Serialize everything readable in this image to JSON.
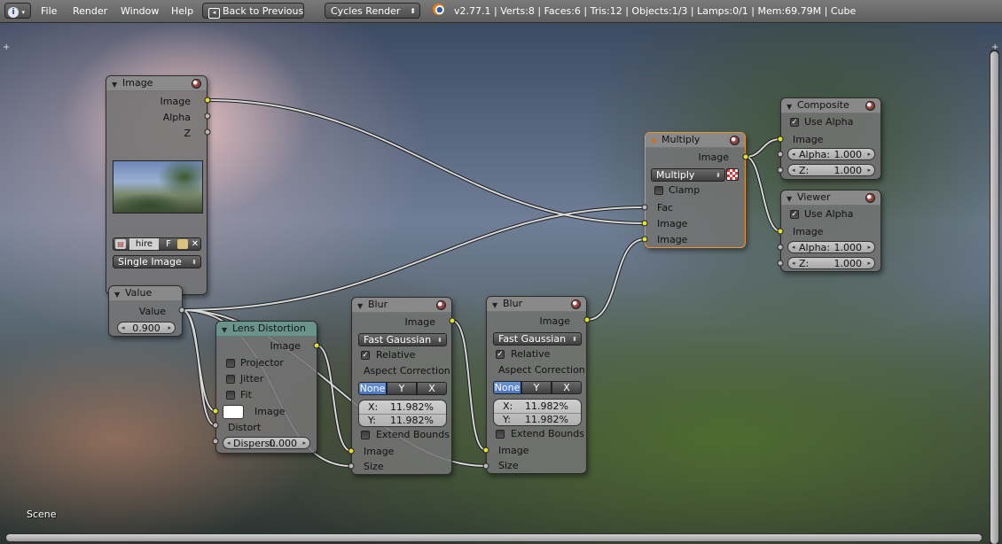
{
  "header": {
    "menu": [
      "File",
      "Render",
      "Window",
      "Help"
    ],
    "back_button": "Back to Previous",
    "render_engine": "Cycles Render",
    "stats": "v2.77.1 | Verts:8 | Faces:6 | Tris:12 | Objects:1/3 | Lamps:0/1 | Mem:69.79M | Cube"
  },
  "footer": {
    "scene_label": "Scene"
  },
  "nodes": {
    "image": {
      "title": "Image",
      "outputs": [
        "Image",
        "Alpha",
        "Z"
      ],
      "image_name": "hire",
      "fake_user": "F",
      "source": "Single Image"
    },
    "value": {
      "title": "Value",
      "output": "Value",
      "value": "0.900"
    },
    "lens": {
      "title": "Lens Distortion",
      "output": "Image",
      "checks": [
        "Projector",
        "Jitter",
        "Fit"
      ],
      "input_image": "Image",
      "input_distort": "Distort",
      "dispersion_label": "Dispersi:",
      "dispersion_value": "0.000"
    },
    "blur1": {
      "title": "Blur",
      "output": "Image",
      "filter": "Fast Gaussian",
      "relative": "Relative",
      "aspect": "Aspect Correction",
      "segments": [
        "None",
        "Y",
        "X"
      ],
      "x_label": "X:",
      "x_value": "11.982%",
      "y_label": "Y:",
      "y_value": "11.982%",
      "extend": "Extend Bounds",
      "in_image": "Image",
      "in_size": "Size"
    },
    "blur2": {
      "title": "Blur",
      "output": "Image",
      "filter": "Fast Gaussian",
      "relative": "Relative",
      "aspect": "Aspect Correction",
      "segments": [
        "None",
        "Y",
        "X"
      ],
      "x_label": "X:",
      "x_value": "11.982%",
      "y_label": "Y:",
      "y_value": "11.982%",
      "extend": "Extend Bounds",
      "in_image": "Image",
      "in_size": "Size"
    },
    "multiply": {
      "title": "Multiply",
      "output": "Image",
      "blend": "Multiply",
      "clamp": "Clamp",
      "inputs": [
        "Fac",
        "Image",
        "Image"
      ]
    },
    "composite": {
      "title": "Composite",
      "use_alpha": "Use Alpha",
      "input": "Image",
      "alpha_label": "Alpha:",
      "alpha_value": "1.000",
      "z_label": "Z:",
      "z_value": "1.000"
    },
    "viewer": {
      "title": "Viewer",
      "use_alpha": "Use Alpha",
      "input": "Image",
      "alpha_label": "Alpha:",
      "alpha_value": "1.000",
      "z_label": "Z:",
      "z_value": "1.000"
    }
  }
}
